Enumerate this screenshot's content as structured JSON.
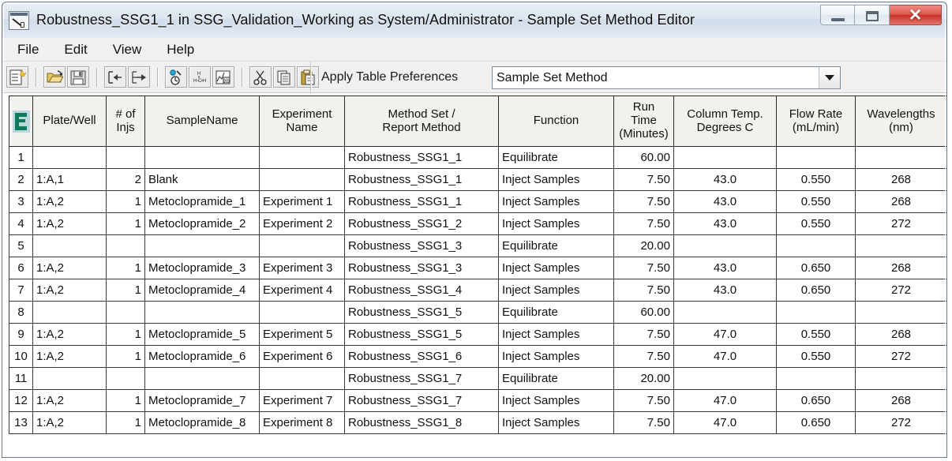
{
  "window": {
    "title": "Robustness_SSG1_1 in SSG_Validation_Working as System/Administrator - Sample Set Method Editor",
    "icon": "sample-set-method-editor-icon",
    "controls": {
      "minimize": "minimize-icon",
      "maximize": "restore-icon",
      "close": "✕"
    }
  },
  "menu": {
    "items": [
      {
        "label": "File"
      },
      {
        "label": "Edit"
      },
      {
        "label": "View"
      },
      {
        "label": "Help"
      }
    ]
  },
  "toolbar": {
    "buttons": [
      {
        "name": "new-sample-set-method-icon"
      },
      {
        "name": "open-icon"
      },
      {
        "name": "save-icon"
      },
      {
        "name": "insert-rows-above-icon"
      },
      {
        "name": "insert-rows-below-icon"
      },
      {
        "name": "sample-vial-icon"
      },
      {
        "name": "molecular-structure-icon"
      },
      {
        "name": "plot-preview-icon"
      },
      {
        "name": "cut-icon"
      },
      {
        "name": "copy-icon"
      },
      {
        "name": "paste-icon"
      }
    ],
    "apply_table_preferences_label": "Apply Table Preferences",
    "preferences_value": "Sample Set Method",
    "preferences_placeholder": "Sample Set Method"
  },
  "table": {
    "columns": [
      {
        "key": "rowhdr",
        "label": ""
      },
      {
        "key": "plate_well",
        "label": "Plate/Well"
      },
      {
        "key": "num_injs",
        "label": "# of\nInjs"
      },
      {
        "key": "sample_name",
        "label": "SampleName"
      },
      {
        "key": "experiment_name",
        "label": "Experiment\nName"
      },
      {
        "key": "method_set",
        "label": "Method Set /\nReport Method"
      },
      {
        "key": "function",
        "label": "Function"
      },
      {
        "key": "run_time",
        "label": "Run\nTime\n(Minutes)"
      },
      {
        "key": "column_temp",
        "label": "Column Temp.\nDegrees C"
      },
      {
        "key": "flow_rate",
        "label": "Flow Rate\n(mL/min)"
      },
      {
        "key": "wavelengths",
        "label": "Wavelengths\n(nm)"
      }
    ],
    "header_lines": {
      "plate_well": [
        "Plate/Well"
      ],
      "num_injs": [
        "# of",
        "Injs"
      ],
      "sample_name": [
        "SampleName"
      ],
      "experiment_name": [
        "Experiment",
        "Name"
      ],
      "method_set": [
        "Method Set /",
        "Report Method"
      ],
      "function": [
        "Function"
      ],
      "run_time": [
        "Run",
        "Time",
        "(Minutes)"
      ],
      "column_temp": [
        "Column Temp.",
        "Degrees C"
      ],
      "flow_rate": [
        "Flow Rate",
        "(mL/min)"
      ],
      "wavelengths": [
        "Wavelengths",
        "(nm)"
      ]
    },
    "rows": [
      {
        "rowhdr": "1",
        "plate_well": "",
        "num_injs": "",
        "sample_name": "",
        "experiment_name": "",
        "method_set": "Robustness_SSG1_1",
        "function": "Equilibrate",
        "run_time": "60.00",
        "column_temp": "",
        "flow_rate": "",
        "wavelengths": "",
        "disabled": [
          "plate_well",
          "num_injs",
          "sample_name",
          "experiment_name",
          "column_temp",
          "flow_rate",
          "wavelengths"
        ]
      },
      {
        "rowhdr": "2",
        "plate_well": "1:A,1",
        "num_injs": "2",
        "sample_name": "Blank",
        "experiment_name": "",
        "method_set": "Robustness_SSG1_1",
        "function": "Inject Samples",
        "run_time": "7.50",
        "column_temp": "43.0",
        "flow_rate": "0.550",
        "wavelengths": "268",
        "disabled": []
      },
      {
        "rowhdr": "3",
        "plate_well": "1:A,2",
        "num_injs": "1",
        "sample_name": "Metoclopramide_1",
        "experiment_name": "Experiment 1",
        "method_set": "Robustness_SSG1_1",
        "function": "Inject Samples",
        "run_time": "7.50",
        "column_temp": "43.0",
        "flow_rate": "0.550",
        "wavelengths": "268",
        "disabled": []
      },
      {
        "rowhdr": "4",
        "plate_well": "1:A,2",
        "num_injs": "1",
        "sample_name": "Metoclopramide_2",
        "experiment_name": "Experiment 2",
        "method_set": "Robustness_SSG1_2",
        "function": "Inject Samples",
        "run_time": "7.50",
        "column_temp": "43.0",
        "flow_rate": "0.550",
        "wavelengths": "272",
        "disabled": []
      },
      {
        "rowhdr": "5",
        "plate_well": "",
        "num_injs": "",
        "sample_name": "",
        "experiment_name": "",
        "method_set": "Robustness_SSG1_3",
        "function": "Equilibrate",
        "run_time": "20.00",
        "column_temp": "",
        "flow_rate": "",
        "wavelengths": "",
        "disabled": [
          "plate_well",
          "num_injs",
          "sample_name",
          "experiment_name",
          "column_temp",
          "flow_rate",
          "wavelengths"
        ]
      },
      {
        "rowhdr": "6",
        "plate_well": "1:A,2",
        "num_injs": "1",
        "sample_name": "Metoclopramide_3",
        "experiment_name": "Experiment 3",
        "method_set": "Robustness_SSG1_3",
        "function": "Inject Samples",
        "run_time": "7.50",
        "column_temp": "43.0",
        "flow_rate": "0.650",
        "wavelengths": "268",
        "disabled": []
      },
      {
        "rowhdr": "7",
        "plate_well": "1:A,2",
        "num_injs": "1",
        "sample_name": "Metoclopramide_4",
        "experiment_name": "Experiment 4",
        "method_set": "Robustness_SSG1_4",
        "function": "Inject Samples",
        "run_time": "7.50",
        "column_temp": "43.0",
        "flow_rate": "0.650",
        "wavelengths": "272",
        "disabled": []
      },
      {
        "rowhdr": "8",
        "plate_well": "",
        "num_injs": "",
        "sample_name": "",
        "experiment_name": "",
        "method_set": "Robustness_SSG1_5",
        "function": "Equilibrate",
        "run_time": "60.00",
        "column_temp": "",
        "flow_rate": "",
        "wavelengths": "",
        "disabled": [
          "plate_well",
          "num_injs",
          "sample_name",
          "experiment_name",
          "column_temp",
          "flow_rate",
          "wavelengths"
        ]
      },
      {
        "rowhdr": "9",
        "plate_well": "1:A,2",
        "num_injs": "1",
        "sample_name": "Metoclopramide_5",
        "experiment_name": "Experiment 5",
        "method_set": "Robustness_SSG1_5",
        "function": "Inject Samples",
        "run_time": "7.50",
        "column_temp": "47.0",
        "flow_rate": "0.550",
        "wavelengths": "268",
        "disabled": []
      },
      {
        "rowhdr": "10",
        "plate_well": "1:A,2",
        "num_injs": "1",
        "sample_name": "Metoclopramide_6",
        "experiment_name": "Experiment 6",
        "method_set": "Robustness_SSG1_6",
        "function": "Inject Samples",
        "run_time": "7.50",
        "column_temp": "47.0",
        "flow_rate": "0.550",
        "wavelengths": "272",
        "disabled": []
      },
      {
        "rowhdr": "11",
        "plate_well": "",
        "num_injs": "",
        "sample_name": "",
        "experiment_name": "",
        "method_set": "Robustness_SSG1_7",
        "function": "Equilibrate",
        "run_time": "20.00",
        "column_temp": "",
        "flow_rate": "",
        "wavelengths": "",
        "disabled": [
          "plate_well",
          "num_injs",
          "sample_name",
          "experiment_name",
          "column_temp",
          "flow_rate",
          "wavelengths"
        ]
      },
      {
        "rowhdr": "12",
        "plate_well": "1:A,2",
        "num_injs": "1",
        "sample_name": "Metoclopramide_7",
        "experiment_name": "Experiment 7",
        "method_set": "Robustness_SSG1_7",
        "function": "Inject Samples",
        "run_time": "7.50",
        "column_temp": "47.0",
        "flow_rate": "0.650",
        "wavelengths": "268",
        "disabled": []
      },
      {
        "rowhdr": "13",
        "plate_well": "1:A,2",
        "num_injs": "1",
        "sample_name": "Metoclopramide_8",
        "experiment_name": "Experiment 8",
        "method_set": "Robustness_SSG1_8",
        "function": "Inject Samples",
        "run_time": "7.50",
        "column_temp": "47.0",
        "flow_rate": "0.650",
        "wavelengths": "272",
        "disabled": []
      }
    ]
  },
  "colors": {
    "titlebar": "#dde6f0",
    "close_button": "#c8322a",
    "disabled_cell": "#818181",
    "header_cell": "#f2f1ee",
    "row_header": "#eceae6",
    "grid_line": "#3a3a3a",
    "corner_icon_accent": "#0f7a5a"
  }
}
